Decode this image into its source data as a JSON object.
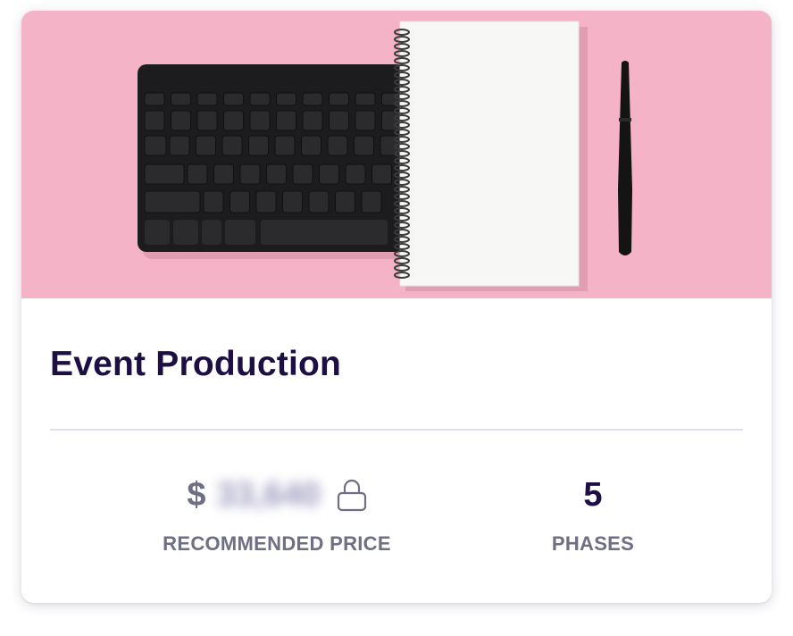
{
  "card": {
    "title": "Event Production",
    "image_alt": "Keyboard, notebook and pen on pink background",
    "recommended_price": {
      "currency_symbol": "$",
      "value_obscured": "33,640",
      "label": "RECOMMENDED PRICE",
      "icon": "lock-icon"
    },
    "phases": {
      "value": "5",
      "label": "PHASES"
    }
  },
  "colors": {
    "hero_background": "#f4b3c6",
    "title": "#1d0f43",
    "label": "#6e6e85",
    "divider": "#e1e0ea"
  }
}
